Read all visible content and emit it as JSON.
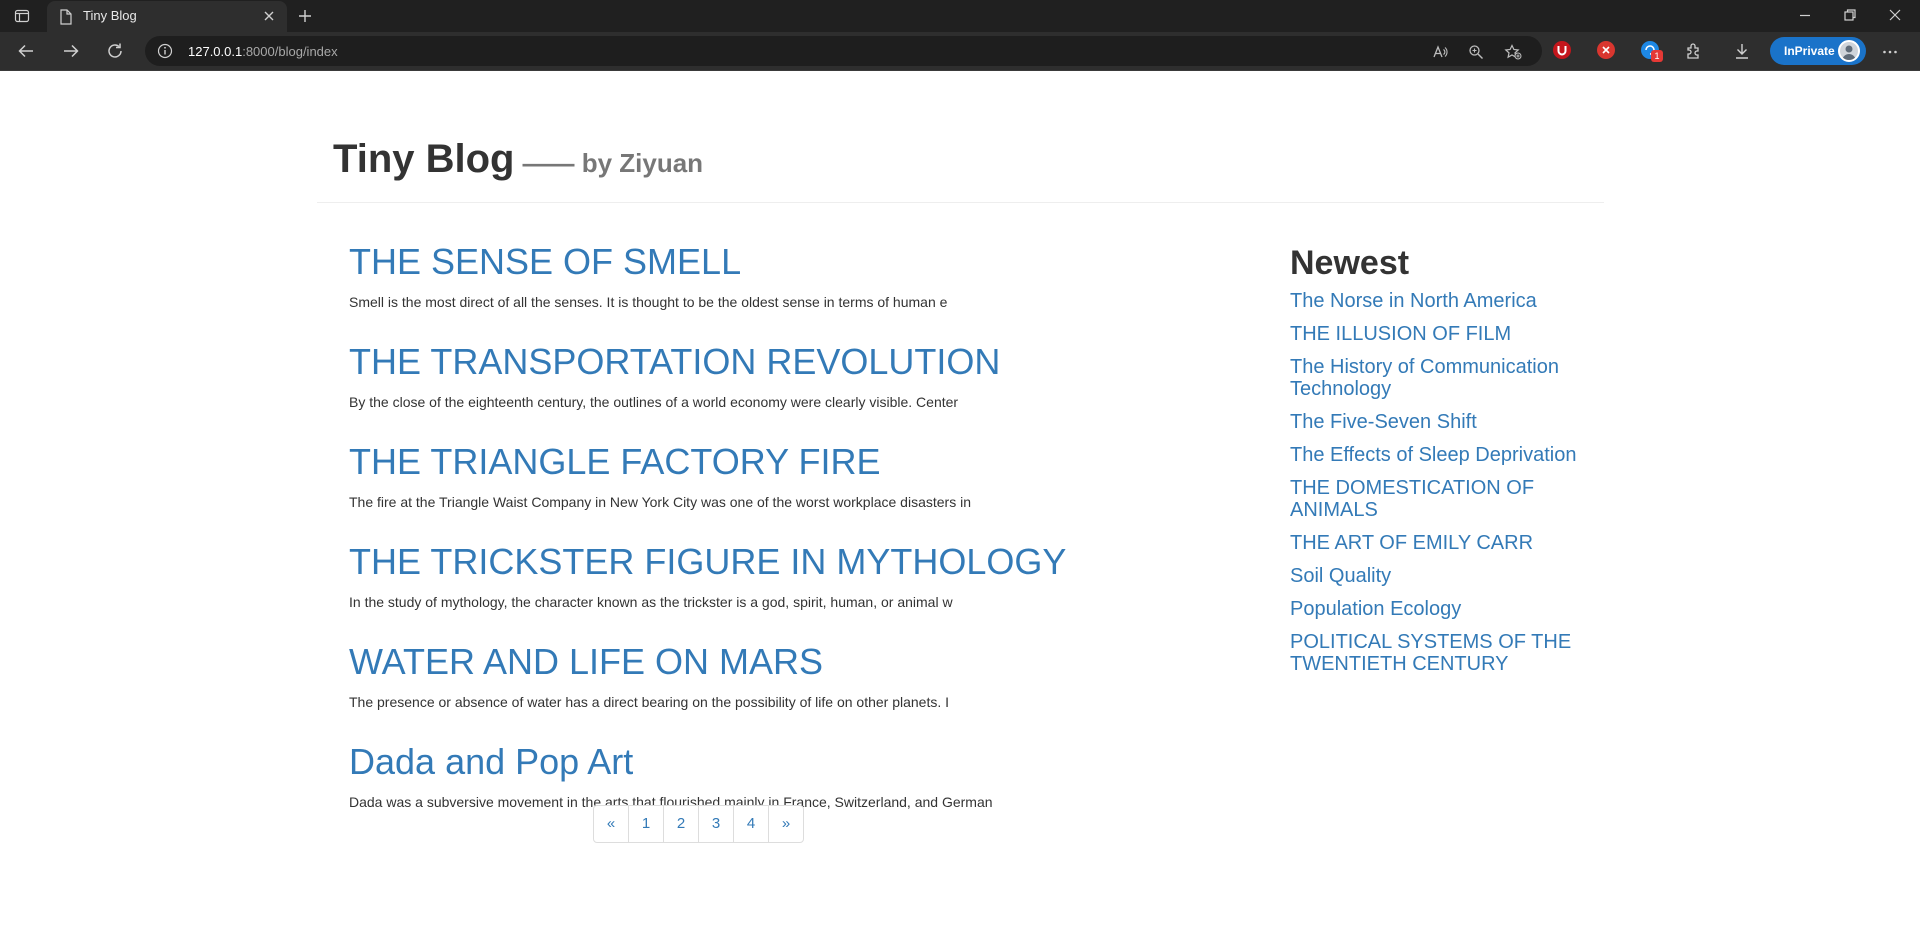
{
  "browser": {
    "tab_title": "Tiny Blog",
    "url_host": "127.0.0.1",
    "url_rest": ":8000/blog/index",
    "inprivate_label": "InPrivate",
    "extension_badge": "1"
  },
  "header": {
    "title": "Tiny Blog",
    "subtitle": "—— by Ziyuan"
  },
  "posts": [
    {
      "title": "THE SENSE OF SMELL",
      "excerpt": "Smell is the most direct of all the senses. It is thought to be the oldest sense in terms of human e"
    },
    {
      "title": "THE TRANSPORTATION REVOLUTION",
      "excerpt": "By the close of the eighteenth century, the outlines of a world economy were clearly visible. Center"
    },
    {
      "title": "THE TRIANGLE FACTORY FIRE",
      "excerpt": "The fire at the Triangle Waist Company in New York City was one of the worst workplace disasters in"
    },
    {
      "title": "THE TRICKSTER FIGURE IN MYTHOLOGY",
      "excerpt": "In the study of mythology, the character known as the trickster is a god, spirit, human, or animal w"
    },
    {
      "title": "WATER AND LIFE ON MARS",
      "excerpt": "The presence or absence of water has a direct bearing on the possibility of life on other planets. I"
    },
    {
      "title": "Dada and Pop Art",
      "excerpt": "Dada was a subversive movement in the arts that flourished mainly in France, Switzerland, and German"
    }
  ],
  "pagination": {
    "prev": "«",
    "pages": [
      "1",
      "2",
      "3",
      "4"
    ],
    "next": "»"
  },
  "sidebar": {
    "title": "Newest",
    "items": [
      "The Norse in North America",
      "THE ILLUSION OF FILM",
      "The History of Communication Technology",
      "The Five-Seven Shift",
      "The Effects of Sleep Deprivation",
      "THE DOMESTICATION OF ANIMALS",
      "THE ART OF EMILY CARR",
      "Soil Quality",
      "Population Ecology",
      "POLITICAL SYSTEMS OF THE TWENTIETH CENTURY"
    ]
  },
  "colors": {
    "link": "#337ab7",
    "text": "#333333",
    "chrome_dark": "#202020",
    "inprivate": "#1a73c9"
  }
}
